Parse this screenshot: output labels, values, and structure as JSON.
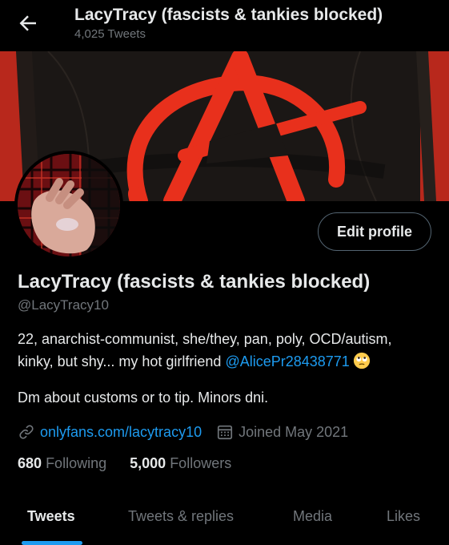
{
  "header": {
    "title": "LacyTracy (fascists & tankies blocked)",
    "tweet_count": "4,025 Tweets",
    "back_icon": "arrow-left-icon"
  },
  "profile": {
    "name": "LacyTracy (fascists & tankies blocked)",
    "handle": "@LacyTracy10",
    "edit_button": "Edit profile",
    "bio_line1": "22, anarchist-communist, she/they, pan, poly, OCD/autism,",
    "bio_line2_prefix": "kinky, but shy... my hot girlfriend ",
    "bio_mention": "@AlicePr28438771",
    "bio_emoji": "face-with-rolling-eyes-emoji",
    "bio_paragraph2": "Dm about customs or to tip. Minors dni.",
    "website": "onlyfans.com/lacytracy10",
    "joined": "Joined May 2021",
    "following_count": "680",
    "following_label": "Following",
    "followers_count": "5,000",
    "followers_label": "Followers"
  },
  "tabs": [
    {
      "label": "Tweets",
      "active": true
    },
    {
      "label": "Tweets & replies",
      "active": false
    },
    {
      "label": "Media",
      "active": false
    },
    {
      "label": "Likes",
      "active": false
    }
  ],
  "colors": {
    "background": "#000000",
    "accent": "#1d9bf0",
    "text": "#e7e9ea",
    "muted": "#71767b",
    "anarchy_red": "#e8301c"
  }
}
